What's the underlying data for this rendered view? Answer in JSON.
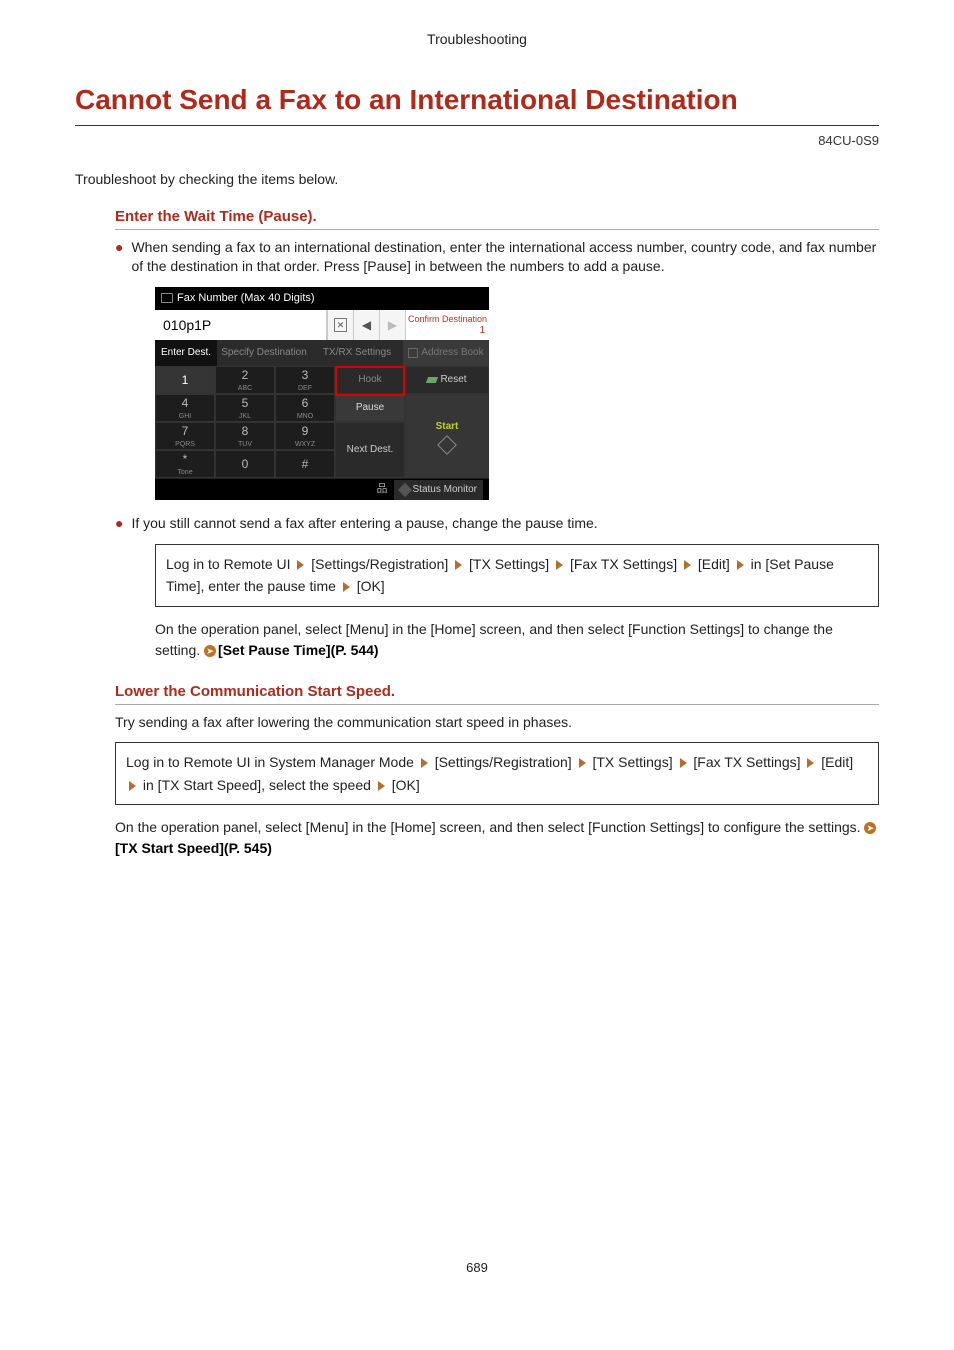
{
  "header": {
    "category": "Troubleshooting"
  },
  "title": "Cannot Send a Fax to an International Destination",
  "doc_code": "84CU-0S9",
  "intro": "Troubleshoot by checking the items below.",
  "section1": {
    "title": "Enter the Wait Time (Pause).",
    "bullet1": "When sending a fax to an international destination, enter the international access number, country code, and fax number of the destination in that order. Press [Pause] in between the numbers to add a pause.",
    "bullet2": "If you still cannot send a fax after entering a pause, change the pause time.",
    "box_parts": {
      "p0": "Log in to Remote UI ",
      "p1": " [Settings/Registration] ",
      "p2": " [TX Settings] ",
      "p3": " [Fax TX Settings] ",
      "p4": " [Edit] ",
      "p5": " in [Set Pause Time], enter the pause time ",
      "p6": " [OK]"
    },
    "note1": "On the operation panel, select [Menu] in the [Home] screen, and then select [Function Settings] to change the setting. ",
    "note1_link": "[Set Pause Time](P. 544)"
  },
  "device": {
    "titlebar": "Fax Number (Max 40 Digits)",
    "input_value": "010p1P",
    "backspace": "⌫",
    "left": "◀",
    "right": "▶",
    "confirm": "Confirm Destination",
    "confirm_n": "1",
    "tabs": {
      "enter": "Enter Dest.",
      "specify": "Specify Destination",
      "txrx": "TX/RX Settings",
      "addr": "Address Book"
    },
    "keys": {
      "k1": "1",
      "k2": "2",
      "k2s": "ABC",
      "k3": "3",
      "k3s": "DEF",
      "k4": "4",
      "k4s": "GHI",
      "k5": "5",
      "k5s": "JKL",
      "k6": "6",
      "k6s": "MNO",
      "k7": "7",
      "k7s": "PQRS",
      "k8": "8",
      "k8s": "TUV",
      "k9": "9",
      "k9s": "WXYZ",
      "kstar": "*",
      "kstars": "Tone",
      "k0": "0",
      "khash": "#"
    },
    "right_btns": {
      "hook": "Hook",
      "pause": "Pause",
      "reset": "Reset",
      "start": "Start",
      "next": "Next Dest."
    },
    "status": "Status Monitor"
  },
  "section2": {
    "title": "Lower the Communication Start Speed.",
    "intro": "Try sending a fax after lowering the communication start speed in phases.",
    "box_parts": {
      "p0": "Log in to Remote UI in System Manager Mode ",
      "p1": " [Settings/Registration] ",
      "p2": " [TX Settings] ",
      "p3": " [Fax TX Settings] ",
      "p4": " [Edit] ",
      "p5": " in [TX Start Speed], select the speed ",
      "p6": " [OK]"
    },
    "note": "On the operation panel, select [Menu] in the [Home] screen, and then select [Function Settings] to configure the settings. ",
    "note_link": "[TX Start Speed](P. 545)"
  },
  "page_number": "689"
}
